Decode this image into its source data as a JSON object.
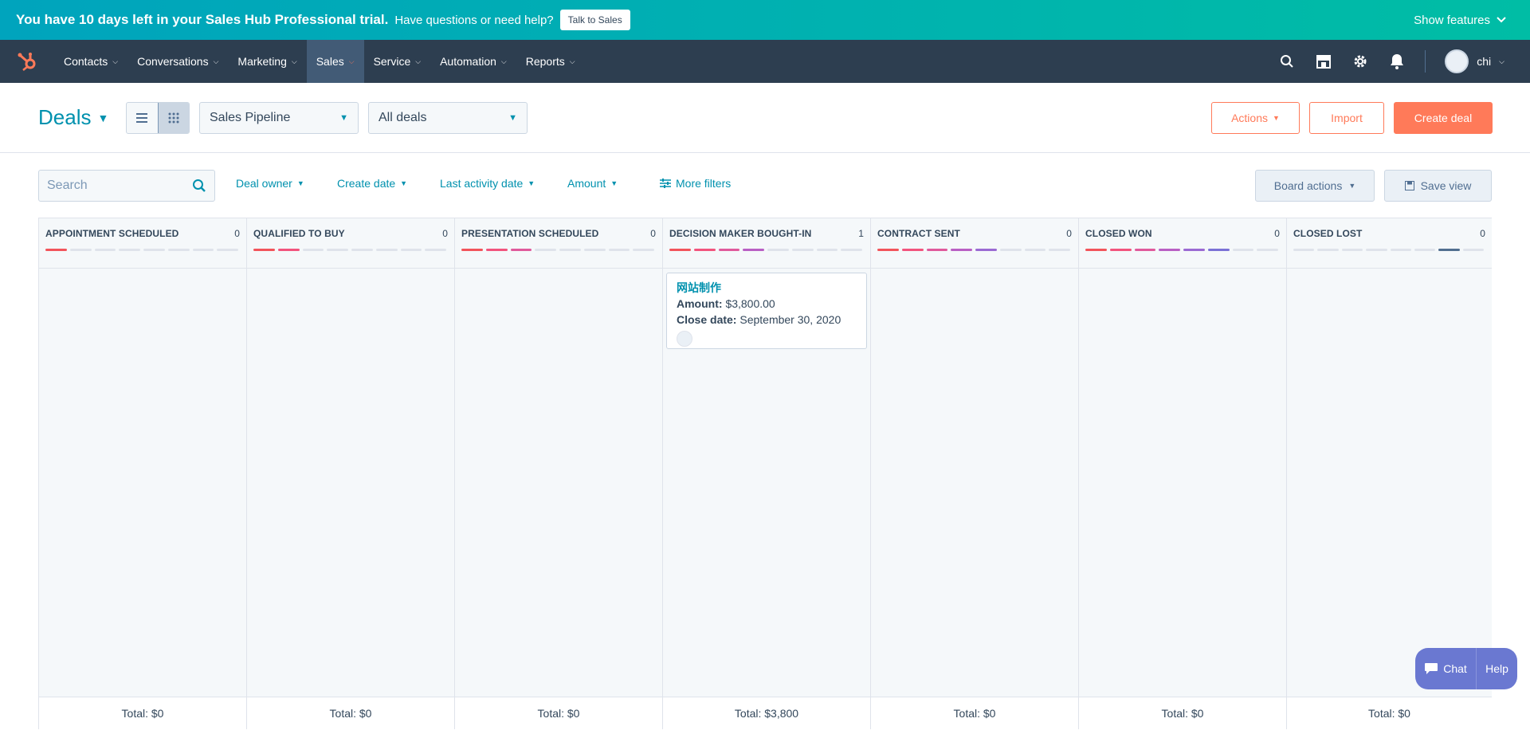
{
  "trial": {
    "message": "You have 10 days left in your Sales Hub Professional trial.",
    "question": "Have questions or need help?",
    "talk_button": "Talk to Sales",
    "show_features": "Show features"
  },
  "nav": {
    "items": [
      "Contacts",
      "Conversations",
      "Marketing",
      "Sales",
      "Service",
      "Automation",
      "Reports"
    ],
    "active": "Sales",
    "user": "chi",
    "icons": [
      "search-icon",
      "marketplace-icon",
      "settings-icon",
      "notifications-icon"
    ]
  },
  "header": {
    "title": "Deals",
    "pipeline": "Sales Pipeline",
    "view": "All deals",
    "actions": "Actions",
    "import": "Import",
    "create": "Create deal"
  },
  "filters": {
    "search_placeholder": "Search",
    "deal_owner": "Deal owner",
    "create_date": "Create date",
    "last_activity": "Last activity date",
    "amount": "Amount",
    "more": "More filters",
    "board_actions": "Board actions",
    "save_view": "Save view"
  },
  "colors": {
    "accent": "#0091ae",
    "brand": "#ff7a59",
    "nav_bg": "#2d3e50",
    "progress": [
      "#f2545b",
      "#f2547d",
      "#e05a9c",
      "#b95fc4",
      "#9b6ad3",
      "#7b71d6",
      "#516f90"
    ]
  },
  "columns": [
    {
      "name": "APPOINTMENT SCHEDULED",
      "count": "0",
      "total": "Total: $0",
      "progress": 1
    },
    {
      "name": "QUALIFIED TO BUY",
      "count": "0",
      "total": "Total: $0",
      "progress": 2
    },
    {
      "name": "PRESENTATION SCHEDULED",
      "count": "0",
      "total": "Total: $0",
      "progress": 3
    },
    {
      "name": "DECISION MAKER BOUGHT-IN",
      "count": "1",
      "total": "Total: $3,800",
      "progress": 4
    },
    {
      "name": "CONTRACT SENT",
      "count": "0",
      "total": "Total: $0",
      "progress": 5
    },
    {
      "name": "CLOSED WON",
      "count": "0",
      "total": "Total: $0",
      "progress": 6
    },
    {
      "name": "CLOSED LOST",
      "count": "0",
      "total": "Total: $0",
      "progress": 0
    }
  ],
  "deal_card": {
    "name": "网站制作",
    "amount_label": "Amount:",
    "amount": "$3,800.00",
    "close_label": "Close date:",
    "close_date": "September 30, 2020"
  },
  "chat": {
    "chat": "Chat",
    "help": "Help"
  }
}
